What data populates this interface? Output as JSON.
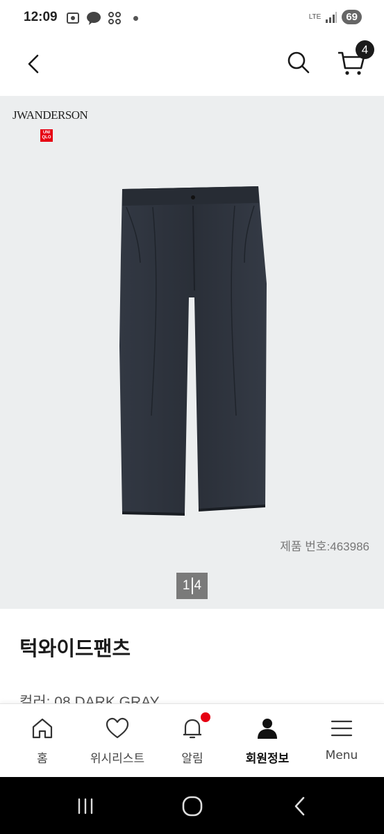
{
  "status_bar": {
    "time": "12:09",
    "network": "LTE",
    "battery": "69"
  },
  "header": {
    "cart_count": "4"
  },
  "product": {
    "brand_name": "JWANDERSON",
    "uniqlo_logo": "UNI QLO",
    "product_number": "제품 번호:463986",
    "image_page_current": "1",
    "image_page_total": "4",
    "name": "턱와이드팬츠",
    "color": "컬러: 08 DARK GRAY"
  },
  "bottom_nav": {
    "items": [
      {
        "label": "홈",
        "icon": "home-icon"
      },
      {
        "label": "위시리스트",
        "icon": "heart-icon"
      },
      {
        "label": "알림",
        "icon": "bell-icon"
      },
      {
        "label": "회원정보",
        "icon": "user-icon"
      },
      {
        "label": "Menu",
        "icon": "menu-icon"
      }
    ]
  },
  "colors": {
    "accent": "#e60012",
    "image_bg": "#eceeef",
    "pants": "#2c313a"
  }
}
